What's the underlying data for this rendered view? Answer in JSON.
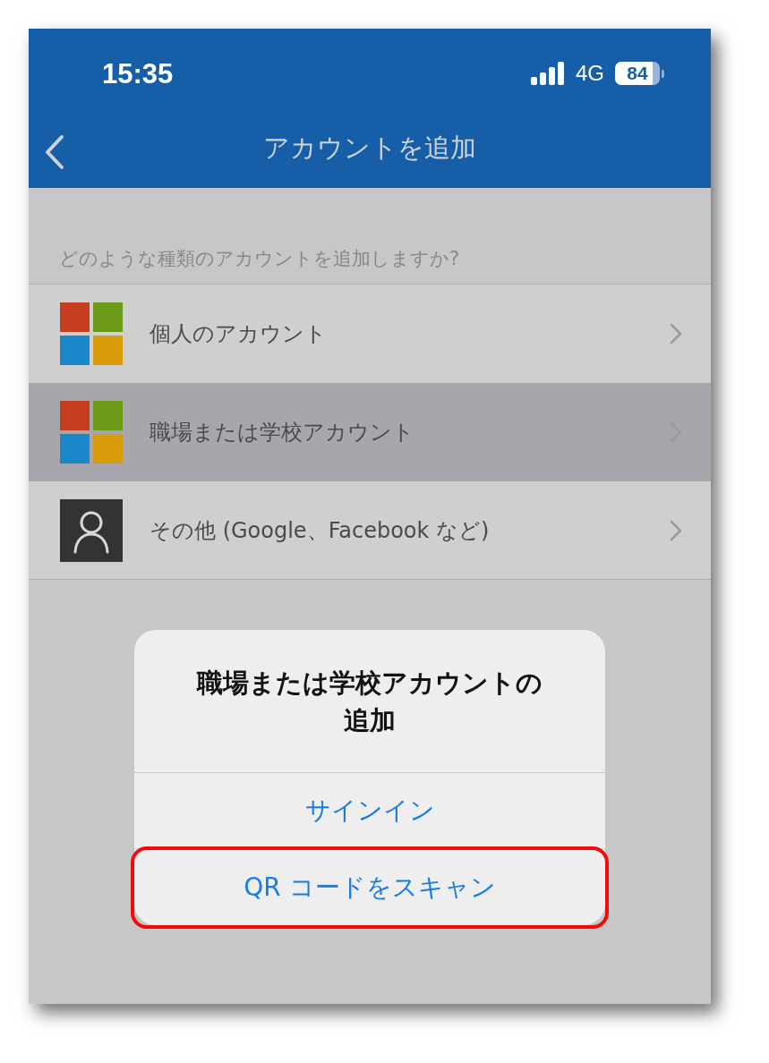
{
  "status_bar": {
    "time": "15:35",
    "network": "4G",
    "battery": "84"
  },
  "nav_bar": {
    "title": "アカウントを追加"
  },
  "section": {
    "header": "どのような種類のアカウントを追加しますか?"
  },
  "accounts": [
    {
      "kind": "tiles",
      "label": "個人のアカウント",
      "selected": false
    },
    {
      "kind": "tiles",
      "label": "職場または学校アカウント",
      "selected": true
    },
    {
      "kind": "person",
      "label": "その他 (Google、Facebook など)",
      "selected": false
    }
  ],
  "dialog": {
    "title": "職場または学校アカウントの追加",
    "actions": [
      {
        "label": "サインイン",
        "highlighted": false
      },
      {
        "label": "QR コードをスキャン",
        "highlighted": true
      }
    ]
  }
}
